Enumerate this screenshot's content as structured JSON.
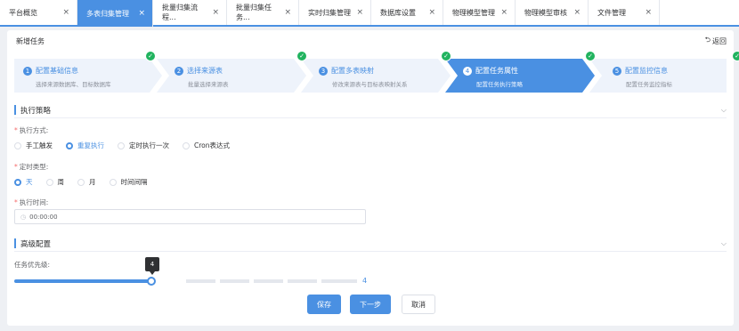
{
  "tabs": [
    {
      "label": "平台概览",
      "active": false
    },
    {
      "label": "多表归集管理",
      "active": true
    },
    {
      "label": "批量归集流程...",
      "active": false
    },
    {
      "label": "批量归集任务...",
      "active": false
    },
    {
      "label": "实时归集管理",
      "active": false
    },
    {
      "label": "数据库设置",
      "active": false
    },
    {
      "label": "物理模型管理",
      "active": false
    },
    {
      "label": "物理模型审核",
      "active": false
    },
    {
      "label": "文件管理",
      "active": false
    }
  ],
  "tab_close": "×",
  "page": {
    "title": "新增任务",
    "back_label": "返回"
  },
  "steps": [
    {
      "num": "1",
      "title": "配置基础信息",
      "desc": "选择来源数据库、目标数据库",
      "done": true
    },
    {
      "num": "2",
      "title": "选择来源表",
      "desc": "批量选择来源表",
      "done": true
    },
    {
      "num": "3",
      "title": "配置多表映射",
      "desc": "修改来源表与目标表映射关系",
      "done": true
    },
    {
      "num": "4",
      "title": "配置任务属性",
      "desc": "配置任务执行策略",
      "done": true
    },
    {
      "num": "5",
      "title": "配置监控信息",
      "desc": "配置任务监控指标",
      "done": true
    }
  ],
  "active_step": 4,
  "sections": {
    "strategy": "执行策略",
    "advanced": "高级配置"
  },
  "exec_mode": {
    "label": "执行方式:",
    "options": [
      "手工触发",
      "重复执行",
      "定时执行一次",
      "Cron表达式"
    ],
    "selected": "重复执行"
  },
  "timing_type": {
    "label": "定时类型:",
    "options": [
      "天",
      "周",
      "月",
      "时间间隔"
    ],
    "selected": "天"
  },
  "exec_time": {
    "label": "执行时间:",
    "value": "00:00:00"
  },
  "priority": {
    "label": "任务优先级:",
    "value": 4,
    "max": 10,
    "tooltip": "4",
    "display": "4"
  },
  "buttons": {
    "save": "保存",
    "next": "下一步",
    "cancel": "取消"
  },
  "colors": {
    "primary": "#4a90e2",
    "success": "#21b35f",
    "required": "#f56c6c"
  },
  "icons": {
    "close": "close-icon",
    "back": "return-arrow-icon",
    "check": "check-circle-icon",
    "chevron": "chevron-down-icon",
    "clock": "clock-icon"
  }
}
